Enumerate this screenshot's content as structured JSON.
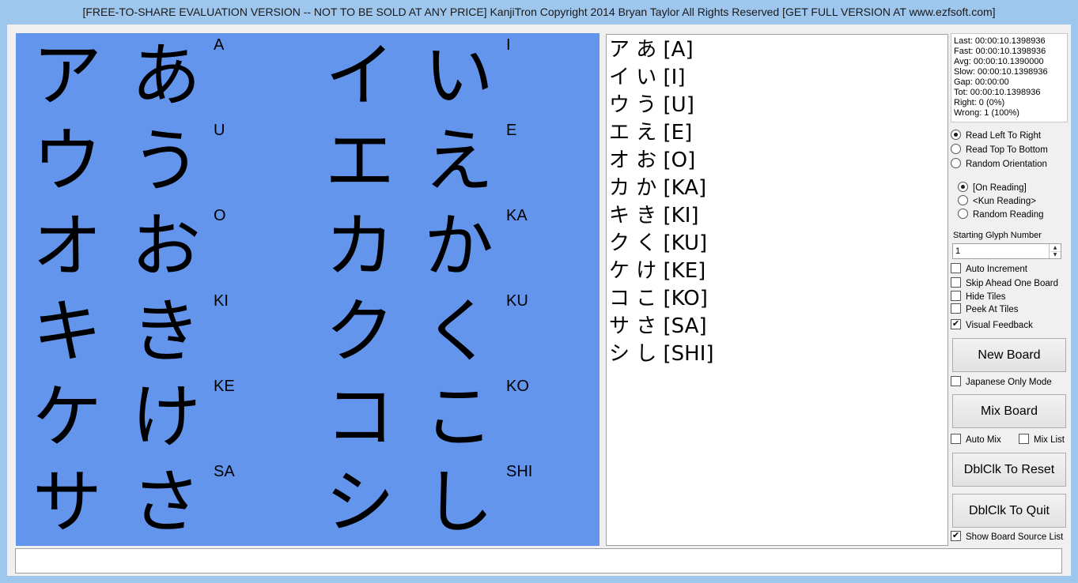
{
  "window": {
    "title": "[FREE-TO-SHARE EVALUATION VERSION -- NOT TO BE SOLD AT ANY PRICE] KanjiTron  Copyright 2014 Bryan Taylor  All Rights Reserved  [GET FULL VERSION AT www.ezfsoft.com]"
  },
  "board": {
    "tiles": [
      {
        "kata": "ア",
        "hira": "あ",
        "romaji": "A"
      },
      {
        "kata": "イ",
        "hira": "い",
        "romaji": "I"
      },
      {
        "kata": "ウ",
        "hira": "う",
        "romaji": "U"
      },
      {
        "kata": "エ",
        "hira": "え",
        "romaji": "E"
      },
      {
        "kata": "オ",
        "hira": "お",
        "romaji": "O"
      },
      {
        "kata": "カ",
        "hira": "か",
        "romaji": "KA"
      },
      {
        "kata": "キ",
        "hira": "き",
        "romaji": "KI"
      },
      {
        "kata": "ク",
        "hira": "く",
        "romaji": "KU"
      },
      {
        "kata": "ケ",
        "hira": "け",
        "romaji": "KE"
      },
      {
        "kata": "コ",
        "hira": "こ",
        "romaji": "KO"
      },
      {
        "kata": "サ",
        "hira": "さ",
        "romaji": "SA"
      },
      {
        "kata": "シ",
        "hira": "し",
        "romaji": "SHI"
      }
    ]
  },
  "source_list": [
    "ア あ [A]",
    "イ い [I]",
    "ウ う [U]",
    "エ え [E]",
    "オ お [O]",
    "カ か [KA]",
    "キ き [KI]",
    "ク く [KU]",
    "ケ け [KE]",
    "コ こ [KO]",
    "サ さ [SA]",
    "シ し [SHI]"
  ],
  "stats": [
    "Last: 00:00:10.1398936",
    "Fast: 00:00:10.1398936",
    "Avg: 00:00:10.1390000",
    "Slow: 00:00:10.1398936",
    "Gap: 00:00:00",
    "Tot: 00:00:10.1398936",
    "Right: 0  (0%)",
    "Wrong: 1  (100%)"
  ],
  "orientation": {
    "options": [
      "Read Left To Right",
      "Read Top To Bottom",
      "Random Orientation"
    ],
    "selected": 0
  },
  "reading": {
    "options": [
      "[On Reading]",
      "<Kun Reading>",
      "Random Reading"
    ],
    "selected": 0
  },
  "starting_glyph": {
    "label": "Starting Glyph Number",
    "value": "1"
  },
  "checkboxes": {
    "auto_increment": {
      "label": "Auto Increment",
      "checked": false
    },
    "skip_ahead": {
      "label": "Skip Ahead One Board",
      "checked": false
    },
    "hide_tiles": {
      "label": "Hide Tiles",
      "checked": false
    },
    "peek_at_tiles": {
      "label": "Peek At Tiles",
      "checked": false
    },
    "visual_feedback": {
      "label": "Visual Feedback",
      "checked": true
    },
    "japanese_only": {
      "label": "Japanese Only Mode",
      "checked": false
    },
    "auto_mix": {
      "label": "Auto Mix",
      "checked": false
    },
    "mix_list": {
      "label": "Mix List",
      "checked": false
    },
    "show_source_list": {
      "label": "Show Board Source List",
      "checked": true
    }
  },
  "buttons": {
    "new_board": "New Board",
    "mix_board": "Mix Board",
    "reset": "DblClk To Reset",
    "quit": "DblClk To Quit"
  },
  "status_text": ""
}
